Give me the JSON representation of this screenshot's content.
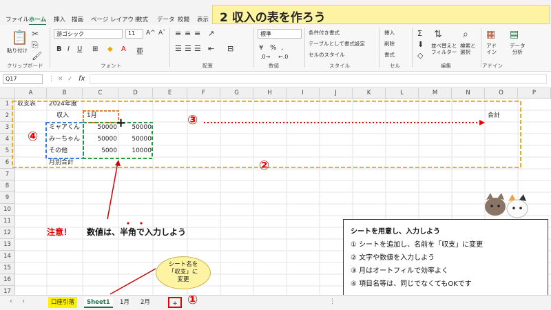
{
  "menu": [
    "ファイル",
    "ホーム",
    "挿入",
    "描画",
    "ページ レイアウト",
    "数式",
    "データ",
    "校閲",
    "表示"
  ],
  "title_banner": "2  収入の表を作ろう",
  "ribbon": {
    "clipboard": {
      "paste": "貼り付け",
      "label": "クリップボード"
    },
    "font": {
      "family": "游ゴシック",
      "size": "11",
      "label": "フォント"
    },
    "alignment": {
      "label": "配置"
    },
    "number": {
      "format": "標準",
      "label": "数値"
    },
    "styles": {
      "cond": "条件付き書式",
      "table": "テーブルとして書式設定",
      "cell": "セルのスタイル",
      "label": "スタイル"
    },
    "cells": {
      "insert": "挿入",
      "delete": "削除",
      "format": "書式",
      "label": "セル"
    },
    "editing": {
      "sort": "並べ替えと\nフィルター",
      "find": "検索と\n選択",
      "label": "編集"
    },
    "addins": {
      "addin": "アド\nイン",
      "analyze": "データ\n分析",
      "label": "アドイン"
    }
  },
  "formula_bar": {
    "namebox": "Q17",
    "fx": "fx",
    "value": ""
  },
  "columns": [
    "A",
    "B",
    "C",
    "D",
    "E",
    "F",
    "G",
    "H",
    "I",
    "J",
    "K",
    "L",
    "M",
    "N",
    "O",
    "P"
  ],
  "rows": [
    "1",
    "2",
    "3",
    "4",
    "5",
    "6",
    "7",
    "8",
    "9",
    "10",
    "11",
    "12",
    "13",
    "14",
    "15",
    "16",
    "17"
  ],
  "cells": {
    "a1": "収支表",
    "b1": "2024年度",
    "b2": "収入",
    "c2": "1月",
    "o2": "合計",
    "b3": "ミャアくん",
    "c3": "50000",
    "d3": "50000",
    "b4": "みーちゃん",
    "c4": "50000",
    "d4": "50000",
    "b5": "その他",
    "c5": "5000",
    "d5": "10000",
    "b6": "月別合計"
  },
  "annotations": {
    "c1": "①",
    "c2": "②",
    "c3": "③",
    "c4": "④",
    "warning_label": "注意！",
    "warning_text": "数値は、半角で入力しよう",
    "callout": "シート名を\n「収支」に\n変更"
  },
  "note": {
    "title": "シートを用意し、入力しよう",
    "items": [
      "①  シートを追加し、名前を「収支」に変更",
      "②  文字や数値を入力しよう",
      "③  月はオートフィルで効率よく",
      "④  項目名等は、同じでなくてもOKです"
    ]
  },
  "sheet_tabs": [
    "口座引落",
    "Sheet1",
    "1月",
    "2月"
  ],
  "add_sheet": "+",
  "colors": {
    "accent_green": "#1e7145",
    "banner": "#fdf3a2",
    "red": "#e60000",
    "orange_dash": "#f0b400",
    "blue_dash": "#3a7bd5",
    "green_dash": "#1f9a3c"
  }
}
